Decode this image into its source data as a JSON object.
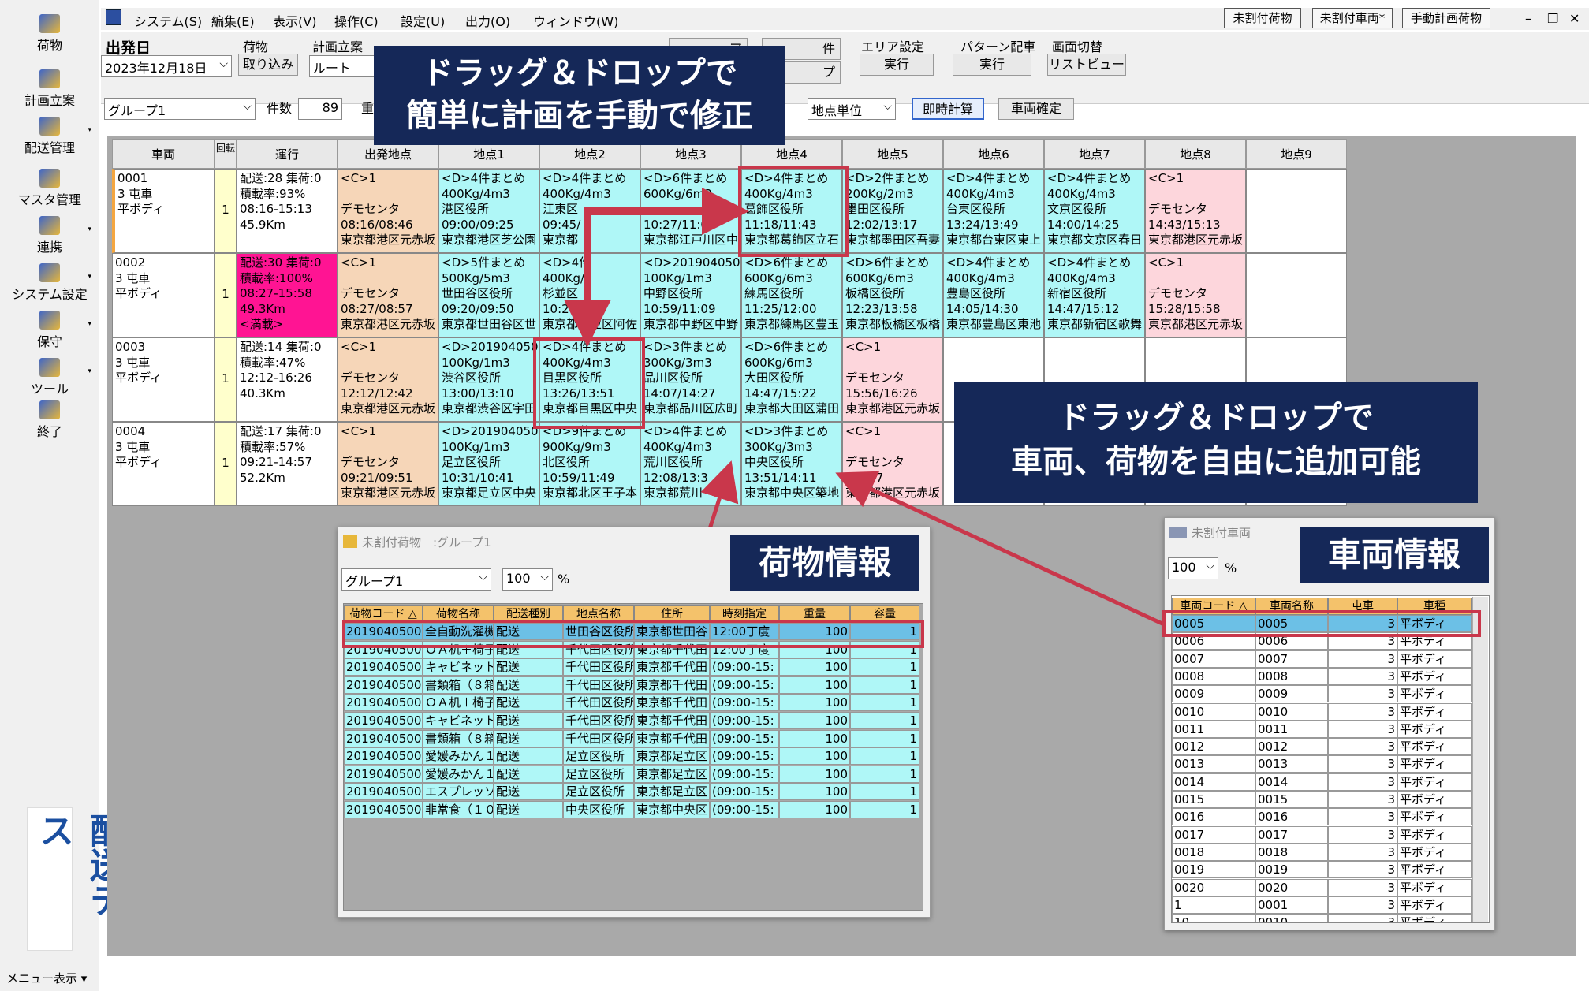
{
  "sidebar": {
    "items": [
      {
        "label": "荷物",
        "icon": "package-icon"
      },
      {
        "label": "計画立案",
        "icon": "truck-icon"
      },
      {
        "label": "配送管理",
        "icon": "delivery-icon",
        "arrow": true
      },
      {
        "label": "マスタ管理",
        "icon": "master-icon"
      },
      {
        "label": "連携",
        "icon": "link-icon",
        "arrow": true
      },
      {
        "label": "システム設定",
        "icon": "settings-icon",
        "arrow": true
      },
      {
        "label": "保守",
        "icon": "maintenance-icon",
        "arrow": true
      },
      {
        "label": "ツール",
        "icon": "tool-icon",
        "arrow": true
      },
      {
        "label": "終了",
        "icon": "exit-icon"
      }
    ],
    "logo": "配送デス",
    "menu_label": "メニュー表示"
  },
  "menubar": {
    "items": [
      "システム(S)",
      "編集(E)",
      "表示(V)",
      "操作(C)",
      "設定(U)",
      "出力(O)",
      "ウィンドウ(W)"
    ],
    "window_buttons": [
      "未割付荷物",
      "未割付車両*",
      "手動計画荷物"
    ]
  },
  "toolbar": {
    "departure_label": "出発日",
    "departure_value": "2023年12月18日",
    "cargo_label": "荷物",
    "cargo_button": "取り込み",
    "plan_label": "計画立案",
    "plan_value": "ルート",
    "area_label": "エリア設定",
    "area_button": "実行",
    "pattern_label": "パターン配車",
    "pattern_button": "実行",
    "switch_label": "画面切替",
    "switch_button": "リストビュー",
    "partial_btn1": "ア",
    "partial_btn2": "件",
    "partial_btn3": "プ",
    "group_value": "グループ1",
    "count_label": "件数",
    "count_value": "89",
    "partial_label": "重",
    "unit_value": "地点単位",
    "calc_button": "即時計算",
    "confirm_button": "車両確定"
  },
  "grid": {
    "headers": [
      "車両",
      "回転",
      "運行",
      "出発地点",
      "地点1",
      "地点2",
      "地点3",
      "地点4",
      "地点5",
      "地点6",
      "地点7",
      "地点8",
      "地点9"
    ],
    "rows": [
      {
        "vehicle": "0001\n3 屯車\n平ボディ",
        "turn": "1",
        "op": "配送:28 集荷:0\n積載率:93%\n08:16-15:13\n45.9Km",
        "op_alert": false,
        "cells": [
          "<C>1\n\nデモセンタ\n08:16/08:46\n東京都港区元赤坂",
          "<D>4件まとめ\n400Kg/4m3\n港区役所\n09:00/09:25\n東京都港区芝公園",
          "<D>4件まとめ\n400Kg/4m3\n江東区\n09:45/\n東京都",
          "<D>6件まとめ\n600Kg/6m3\n\n10:27/11:02\n東京都江戸川区中",
          "<D>4件まとめ\n400Kg/4m3\n葛飾区役所\n11:18/11:43\n東京都葛飾区立石",
          "<D>2件まとめ\n200Kg/2m3\n墨田区役所\n12:02/13:17\n東京都墨田区吾妻",
          "<D>4件まとめ\n400Kg/4m3\n台東区役所\n13:24/13:49\n東京都台東区東上",
          "<D>4件まとめ\n400Kg/4m3\n文京区役所\n14:00/14:25\n東京都文京区春日",
          "<C>1\n\nデモセンタ\n14:43/15:13\n東京都港区元赤坂",
          ""
        ]
      },
      {
        "vehicle": "0002\n3 屯車\n平ボディ",
        "turn": "1",
        "op": "配送:30 集荷:0\n積載率:100%\n08:27-15:58\n49.3Km\n<満載>",
        "op_alert": true,
        "cells": [
          "<C>1\n\nデモセンタ\n08:27/08:57\n東京都港区元赤坂",
          "<D>5件まとめ\n500Kg/5m3\n世田谷区役所\n09:20/09:50\n東京都世田谷区世",
          "<D>4件\n400Kg/\n杉並区\n10:2\n東京都杉並区阿佐",
          "<D>201904050\n100Kg/1m3\n中野区役所\n10:59/11:09\n東京都中野区中野",
          "<D>6件まとめ\n600Kg/6m3\n練馬区役所\n11:25/12:00\n東京都練馬区豊玉",
          "<D>6件まとめ\n600Kg/6m3\n板橋区役所\n12:23/13:58\n東京都板橋区板橋",
          "<D>4件まとめ\n400Kg/4m3\n豊島区役所\n14:05/14:30\n東京都豊島区東池",
          "<D>4件まとめ\n400Kg/4m3\n新宿区役所\n14:47/15:12\n東京都新宿区歌舞",
          "<C>1\n\nデモセンタ\n15:28/15:58\n東京都港区元赤坂",
          ""
        ]
      },
      {
        "vehicle": "0003\n3 屯車\n平ボディ",
        "turn": "1",
        "op": "配送:14 集荷:0\n積載率:47%\n12:12-16:26\n40.3Km",
        "op_alert": false,
        "cells": [
          "<C>1\n\nデモセンタ\n12:12/12:42\n東京都港区元赤坂",
          "<D>201904050\n100Kg/1m3\n渋谷区役所\n13:00/13:10\n東京都渋谷区宇田",
          "<D>4件まとめ\n400Kg/4m3\n目黒区役所\n13:26/13:51\n東京都目黒区中央",
          "<D>3件まとめ\n300Kg/3m3\n品川区役所\n14:07/14:27\n東京都品川区広町",
          "<D>6件まとめ\n600Kg/6m3\n大田区役所\n14:47/15:22\n東京都大田区蒲田",
          "<C>1\n\nデモセンタ\n15:56/16:26\n東京都港区元赤坂",
          "",
          "",
          "",
          ""
        ]
      },
      {
        "vehicle": "0004\n3 屯車\n平ボディ",
        "turn": "1",
        "op": "配送:17 集荷:0\n積載率:57%\n09:21-14:57\n52.2Km",
        "op_alert": false,
        "cells": [
          "<C>1\n\nデモセンタ\n09:21/09:51\n東京都港区元赤坂",
          "<D>201904050\n100Kg/1m3\n足立区役所\n10:31/10:41\n東京都足立区中央",
          "<D>9件まとめ\n900Kg/9m3\n北区役所\n10:59/11:49\n東京都北区王子本",
          "<D>4件まとめ\n400Kg/4m3\n荒川区役所\n12:08/13:3\n東京都荒川",
          "<D>3件まとめ\n300Kg/3m3\n中央区役所\n13:51/14:11\n東京都中央区築地",
          "<C>1\n\nデモセンタ\n/14:57\n東京都港区元赤坂",
          "",
          "",
          "",
          ""
        ]
      }
    ]
  },
  "callouts": {
    "top": "ドラッグ＆ドロップで\n簡単に計画を手動で修正",
    "right": "ドラッグ＆ドロップで\n車両、荷物を自由に追加可能",
    "cargo": "荷物情報",
    "vehicle": "車両情報"
  },
  "cargo_dialog": {
    "title": "未割付荷物　:グループ1",
    "group": "グループ1",
    "percent": "100",
    "pct_sign": "%",
    "headers": [
      "荷物コード △",
      "荷物名称",
      "配送種別",
      "地点名称",
      "住所",
      "時刻指定",
      "重量",
      "容量"
    ],
    "rows": [
      [
        "2019040500",
        "全自動洗濯機",
        "配送",
        "世田谷区役所",
        "東京都世田谷",
        "12:00丁度",
        "100",
        "1"
      ],
      [
        "2019040500",
        "ＯＡ机＋椅子",
        "配送",
        "千代田区役所",
        "東京都千代田",
        "12:00丁度",
        "100",
        "1"
      ],
      [
        "2019040500",
        "キャビネット（",
        "配送",
        "千代田区役所",
        "東京都千代田",
        "(09:00-15:",
        "100",
        "1"
      ],
      [
        "2019040500",
        "書類箱（８箱",
        "配送",
        "千代田区役所",
        "東京都千代田",
        "(09:00-15:",
        "100",
        "1"
      ],
      [
        "2019040500",
        "ＯＡ机＋椅子",
        "配送",
        "千代田区役所",
        "東京都千代田",
        "(09:00-15:",
        "100",
        "1"
      ],
      [
        "2019040500",
        "キャビネット（",
        "配送",
        "千代田区役所",
        "東京都千代田",
        "(09:00-15:",
        "100",
        "1"
      ],
      [
        "2019040500",
        "書類箱（８箱",
        "配送",
        "千代田区役所",
        "東京都千代田",
        "(09:00-15:",
        "100",
        "1"
      ],
      [
        "2019040500",
        "愛媛みかん１",
        "配送",
        "足立区役所",
        "東京都足立区",
        "(09:00-15:",
        "100",
        "1"
      ],
      [
        "2019040500",
        "愛媛みかん１",
        "配送",
        "足立区役所",
        "東京都足立区",
        "(09:00-15:",
        "100",
        "1"
      ],
      [
        "2019040500",
        "エスプレッソメー",
        "配送",
        "足立区役所",
        "東京都足立区",
        "(09:00-15:",
        "100",
        "1"
      ],
      [
        "2019040500",
        "非常食（１０",
        "配送",
        "中央区役所",
        "東京都中央区",
        "(09:00-15:",
        "100",
        "1"
      ]
    ]
  },
  "vehicle_dialog": {
    "title": "未割付車両",
    "percent": "100",
    "pct_sign": "%",
    "headers": [
      "車両コード △",
      "車両名称",
      "屯車",
      "車種"
    ],
    "rows": [
      [
        "0005",
        "0005",
        "3",
        "平ボディ"
      ],
      [
        "0006",
        "0006",
        "3",
        "平ボディ"
      ],
      [
        "0007",
        "0007",
        "3",
        "平ボディ"
      ],
      [
        "0008",
        "0008",
        "3",
        "平ボディ"
      ],
      [
        "0009",
        "0009",
        "3",
        "平ボディ"
      ],
      [
        "0010",
        "0010",
        "3",
        "平ボディ"
      ],
      [
        "0011",
        "0011",
        "3",
        "平ボディ"
      ],
      [
        "0012",
        "0012",
        "3",
        "平ボディ"
      ],
      [
        "0013",
        "0013",
        "3",
        "平ボディ"
      ],
      [
        "0014",
        "0014",
        "3",
        "平ボディ"
      ],
      [
        "0015",
        "0015",
        "3",
        "平ボディ"
      ],
      [
        "0016",
        "0016",
        "3",
        "平ボディ"
      ],
      [
        "0017",
        "0017",
        "3",
        "平ボディ"
      ],
      [
        "0018",
        "0018",
        "3",
        "平ボディ"
      ],
      [
        "0019",
        "0019",
        "3",
        "平ボディ"
      ],
      [
        "0020",
        "0020",
        "3",
        "平ボディ"
      ],
      [
        "1",
        "0001",
        "3",
        "平ボディ"
      ],
      [
        "10",
        "0010",
        "3",
        "平ボディ"
      ]
    ]
  },
  "colors": {
    "depart": "#f6d6b8",
    "visit": "#aff7f7",
    "return": "#fdd6dc",
    "alert": "#ff1493",
    "callout": "#152858",
    "red": "#c9374b",
    "turn": "#ffffcc"
  }
}
